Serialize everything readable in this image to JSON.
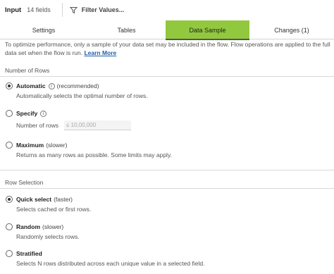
{
  "header": {
    "title": "Input",
    "field_count": "14 fields",
    "filter_label": "Filter Values..."
  },
  "tabs": [
    {
      "label": "Settings"
    },
    {
      "label": "Tables"
    },
    {
      "label": "Data Sample",
      "active": true
    },
    {
      "label": "Changes (1)"
    }
  ],
  "info": {
    "text": "To optimize performance, only a sample of your data set may be included in the flow. Flow operations are applied to the full data set when the flow is run.",
    "link": "Learn More"
  },
  "number_of_rows": {
    "heading": "Number of Rows",
    "options": [
      {
        "name": "Automatic",
        "hint": "(recommended)",
        "desc": "Automatically selects the optimal number of rows.",
        "checked": true
      },
      {
        "name": "Specify",
        "hint": "",
        "rows_label": "Number of rows",
        "rows_placeholder": "≤ 10,00,000",
        "checked": false
      },
      {
        "name": "Maximum",
        "hint": "(slower)",
        "desc": "Returns as many rows as possible. Some limits may apply.",
        "checked": false
      }
    ]
  },
  "row_selection": {
    "heading": "Row Selection",
    "options": [
      {
        "name": "Quick select",
        "hint": "(faster)",
        "desc": "Selects cached or first rows.",
        "checked": true
      },
      {
        "name": "Random",
        "hint": "(slower)",
        "desc": "Randomly selects rows.",
        "checked": false
      },
      {
        "name": "Stratified",
        "hint": "",
        "desc": "Selects N rows distributed across each unique value in a selected field.",
        "checked": false
      }
    ]
  },
  "colors": {
    "active_tab": "#92c83e",
    "link": "#1f5da8"
  },
  "icons": {
    "filter": "funnel-icon",
    "info": "info-icon"
  }
}
